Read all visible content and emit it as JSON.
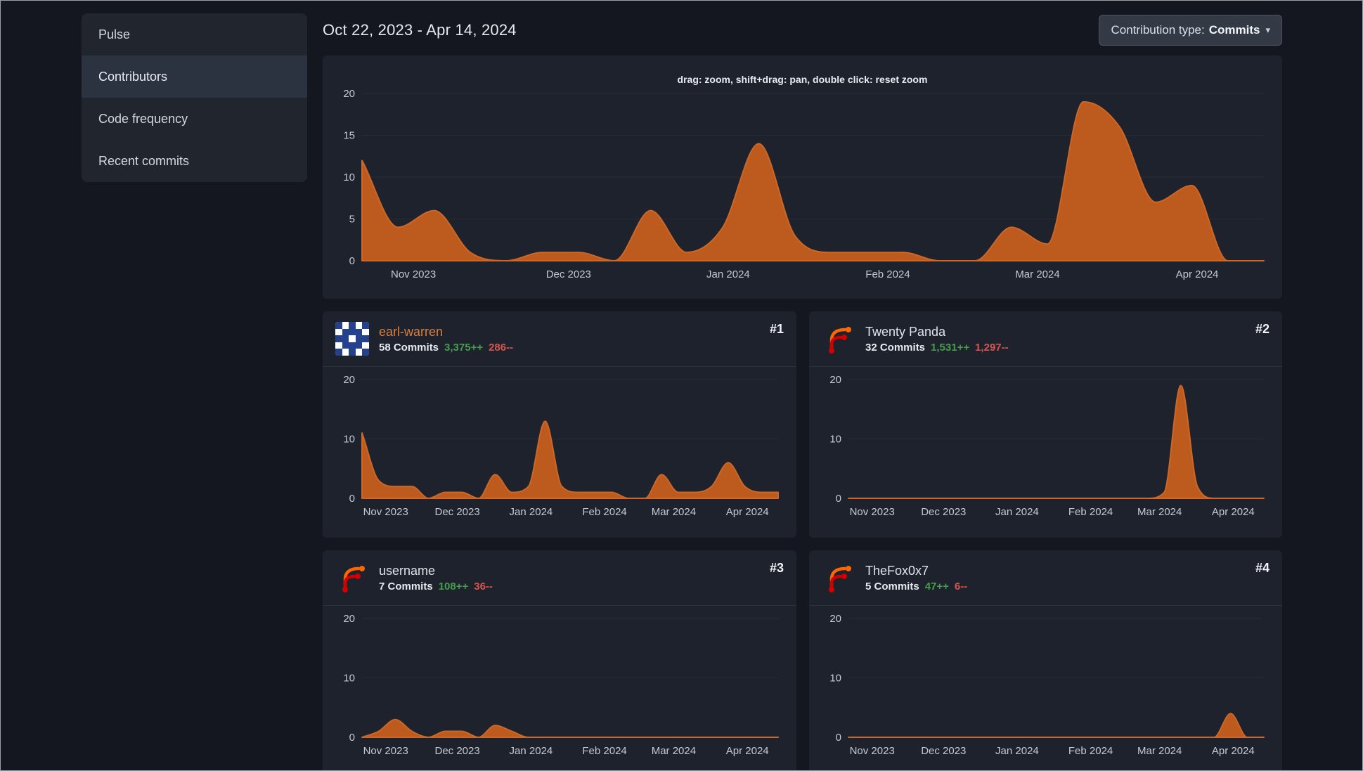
{
  "colors": {
    "chart_fill": "#bd5a1e",
    "chart_line": "#cc6727",
    "grid": "#262c37",
    "axis_line": "#4a5260",
    "axis_text": "#c4cad3",
    "green": "#469e4d",
    "red": "#d9544d",
    "accent_orange": "#d8803f",
    "panel_bg": "#1d222c",
    "page_bg": "#14171f"
  },
  "sidebar": {
    "items": [
      {
        "label": "Pulse",
        "active": false
      },
      {
        "label": "Contributors",
        "active": true
      },
      {
        "label": "Code frequency",
        "active": false
      },
      {
        "label": "Recent commits",
        "active": false
      }
    ]
  },
  "header": {
    "date_range": "Oct 22, 2023 - Apr 14, 2024",
    "contribution_type_label": "Contribution type:",
    "contribution_type_value": "Commits",
    "caret": "▾"
  },
  "contributors": [
    {
      "rank": "#1",
      "name": "earl-warren",
      "commits": "58 Commits",
      "additions": "3,375++",
      "deletions": "286--",
      "avatar": "identicon",
      "avatar_colors": {
        "fg": "#24418e",
        "bg": "#ffffff"
      },
      "avatar_pattern": [
        "BWBWB",
        "WBBBW",
        "BBWBB",
        "WBBBW",
        "BWBWB"
      ]
    },
    {
      "rank": "#2",
      "name": "Twenty Panda",
      "commits": "32 Commits",
      "additions": "1,531++",
      "deletions": "1,297--",
      "avatar": "forgejo-logo"
    },
    {
      "rank": "#3",
      "name": "username",
      "commits": "7 Commits",
      "additions": "108++",
      "deletions": "36--",
      "avatar": "forgejo-logo"
    },
    {
      "rank": "#4",
      "name": "TheFox0x7",
      "commits": "5 Commits",
      "additions": "47++",
      "deletions": "6--",
      "avatar": "forgejo-logo"
    }
  ],
  "chart_data": [
    {
      "id": "overall-contributions",
      "type": "area",
      "hint": "drag: zoom, shift+drag: pan, double click: reset zoom",
      "x_start": "Oct 22, 2023",
      "x_end": "Apr 14, 2024",
      "x_unit": "week",
      "grid": true,
      "legend": "none",
      "margins": {
        "l": 56,
        "r": 26,
        "t": 10,
        "b": 54
      },
      "ylim": [
        0,
        20
      ],
      "yticks": [
        0,
        5,
        10,
        15,
        20
      ],
      "x_ticks": [
        {
          "label": "Nov 2023",
          "frac": 0.057
        },
        {
          "label": "Dec 2023",
          "frac": 0.229
        },
        {
          "label": "Jan 2024",
          "frac": 0.406
        },
        {
          "label": "Feb 2024",
          "frac": 0.583
        },
        {
          "label": "Mar 2024",
          "frac": 0.749
        },
        {
          "label": "Apr 2024",
          "frac": 0.926
        }
      ],
      "series": [
        {
          "name": "commits",
          "values": [
            12,
            4,
            6,
            1,
            0,
            1,
            1,
            0,
            6,
            1,
            4,
            14,
            3,
            1,
            1,
            1,
            0,
            0,
            4,
            2,
            19,
            16,
            7,
            9,
            0,
            0
          ]
        }
      ]
    },
    {
      "id": "earl-warren-commits",
      "type": "area",
      "x_start": "Oct 22, 2023",
      "x_end": "Apr 14, 2024",
      "x_unit": "week",
      "grid": true,
      "margins": {
        "l": 56,
        "r": 26,
        "t": 18,
        "b": 56
      },
      "ylim": [
        0,
        20
      ],
      "yticks": [
        0,
        10,
        20
      ],
      "x_ticks": [
        {
          "label": "Nov 2023",
          "frac": 0.057
        },
        {
          "label": "Dec 2023",
          "frac": 0.229
        },
        {
          "label": "Jan 2024",
          "frac": 0.406
        },
        {
          "label": "Feb 2024",
          "frac": 0.583
        },
        {
          "label": "Mar 2024",
          "frac": 0.749
        },
        {
          "label": "Apr 2024",
          "frac": 0.926
        }
      ],
      "series": [
        {
          "name": "commits",
          "values": [
            11,
            3,
            2,
            2,
            0,
            1,
            1,
            0,
            4,
            1,
            2,
            13,
            2,
            1,
            1,
            1,
            0,
            0,
            4,
            1,
            1,
            2,
            6,
            2,
            1,
            1
          ]
        }
      ]
    },
    {
      "id": "twenty-panda-commits",
      "type": "area",
      "x_start": "Oct 22, 2023",
      "x_end": "Apr 14, 2024",
      "x_unit": "week",
      "grid": true,
      "margins": {
        "l": 56,
        "r": 26,
        "t": 18,
        "b": 56
      },
      "ylim": [
        0,
        20
      ],
      "yticks": [
        0,
        10,
        20
      ],
      "x_ticks": [
        {
          "label": "Nov 2023",
          "frac": 0.057
        },
        {
          "label": "Dec 2023",
          "frac": 0.229
        },
        {
          "label": "Jan 2024",
          "frac": 0.406
        },
        {
          "label": "Feb 2024",
          "frac": 0.583
        },
        {
          "label": "Mar 2024",
          "frac": 0.749
        },
        {
          "label": "Apr 2024",
          "frac": 0.926
        }
      ],
      "series": [
        {
          "name": "commits",
          "values": [
            0,
            0,
            0,
            0,
            0,
            0,
            0,
            0,
            0,
            0,
            0,
            0,
            0,
            0,
            0,
            0,
            0,
            0,
            0,
            1,
            19,
            2,
            0,
            0,
            0,
            0
          ]
        }
      ]
    },
    {
      "id": "username-commits",
      "type": "area",
      "x_start": "Oct 22, 2023",
      "x_end": "Apr 14, 2024",
      "x_unit": "week",
      "grid": true,
      "margins": {
        "l": 56,
        "r": 26,
        "t": 18,
        "b": 56
      },
      "ylim": [
        0,
        20
      ],
      "yticks": [
        0,
        10,
        20
      ],
      "x_ticks": [
        {
          "label": "Nov 2023",
          "frac": 0.057
        },
        {
          "label": "Dec 2023",
          "frac": 0.229
        },
        {
          "label": "Jan 2024",
          "frac": 0.406
        },
        {
          "label": "Feb 2024",
          "frac": 0.583
        },
        {
          "label": "Mar 2024",
          "frac": 0.749
        },
        {
          "label": "Apr 2024",
          "frac": 0.926
        }
      ],
      "series": [
        {
          "name": "commits",
          "values": [
            0,
            1,
            3,
            1,
            0,
            1,
            1,
            0,
            2,
            1,
            0,
            0,
            0,
            0,
            0,
            0,
            0,
            0,
            0,
            0,
            0,
            0,
            0,
            0,
            0,
            0
          ]
        }
      ]
    },
    {
      "id": "thefox0x7-commits",
      "type": "area",
      "x_start": "Oct 22, 2023",
      "x_end": "Apr 14, 2024",
      "x_unit": "week",
      "grid": true,
      "margins": {
        "l": 56,
        "r": 26,
        "t": 18,
        "b": 56
      },
      "ylim": [
        0,
        20
      ],
      "yticks": [
        0,
        10,
        20
      ],
      "x_ticks": [
        {
          "label": "Nov 2023",
          "frac": 0.057
        },
        {
          "label": "Dec 2023",
          "frac": 0.229
        },
        {
          "label": "Jan 2024",
          "frac": 0.406
        },
        {
          "label": "Feb 2024",
          "frac": 0.583
        },
        {
          "label": "Mar 2024",
          "frac": 0.749
        },
        {
          "label": "Apr 2024",
          "frac": 0.926
        }
      ],
      "series": [
        {
          "name": "commits",
          "values": [
            0,
            0,
            0,
            0,
            0,
            0,
            0,
            0,
            0,
            0,
            0,
            0,
            0,
            0,
            0,
            0,
            0,
            0,
            0,
            0,
            0,
            0,
            0,
            4,
            0,
            0
          ]
        }
      ]
    }
  ]
}
